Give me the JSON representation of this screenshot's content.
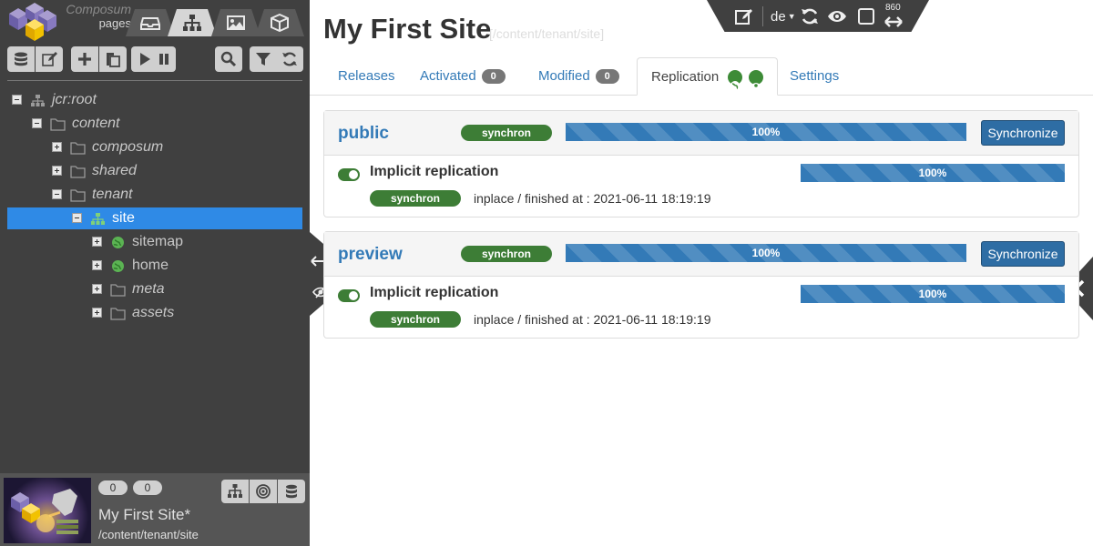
{
  "brand": {
    "line1": "Composum",
    "line2": "pages"
  },
  "toolbar_right": {
    "language": "de",
    "width_value": "860"
  },
  "tree": [
    {
      "label": "jcr:root",
      "italic": true,
      "toggle": "minus",
      "icon": "sitemap-icon",
      "selected": false
    },
    {
      "label": "content",
      "italic": true,
      "toggle": "minus",
      "icon": "folder-icon",
      "selected": false
    },
    {
      "label": "composum",
      "italic": true,
      "toggle": "plus",
      "icon": "folder-icon",
      "selected": false
    },
    {
      "label": "shared",
      "italic": true,
      "toggle": "plus",
      "icon": "folder-icon",
      "selected": false
    },
    {
      "label": "tenant",
      "italic": true,
      "toggle": "minus",
      "icon": "folder-icon",
      "selected": false
    },
    {
      "label": "site",
      "italic": false,
      "toggle": "minus",
      "icon": "sitemap-icon",
      "selected": true
    },
    {
      "label": "sitemap",
      "italic": false,
      "toggle": "plus",
      "icon": "globe-icon",
      "selected": false
    },
    {
      "label": "home",
      "italic": false,
      "toggle": "plus",
      "icon": "globe-icon",
      "selected": false
    },
    {
      "label": "meta",
      "italic": true,
      "toggle": "plus",
      "icon": "folder-icon",
      "selected": false
    },
    {
      "label": "assets",
      "italic": true,
      "toggle": "plus",
      "icon": "folder-icon",
      "selected": false
    }
  ],
  "bottom": {
    "count1": "0",
    "count2": "0",
    "title": "My First Site*",
    "path": "/content/tenant/site"
  },
  "page": {
    "title": "My First Site",
    "path": "[/content/tenant/site]"
  },
  "tabs": {
    "releases": "Releases",
    "activated": "Activated",
    "activated_count": "0",
    "modified": "Modified",
    "modified_count": "0",
    "replication": "Replication",
    "settings": "Settings"
  },
  "panels": [
    {
      "name": "public",
      "state": "synchron",
      "progress": "100%",
      "progress_value": 100,
      "button": "Synchronize",
      "implicit_label": "Implicit replication",
      "implicit_state": "synchron",
      "implicit_progress": "100%",
      "implicit_progress_value": 100,
      "info": "inplace  /  finished at : 2021-06-11 18:19:19"
    },
    {
      "name": "preview",
      "state": "synchron",
      "progress": "100%",
      "progress_value": 100,
      "button": "Synchronize",
      "implicit_label": "Implicit replication",
      "implicit_state": "synchron",
      "implicit_progress": "100%",
      "implicit_progress_value": 100,
      "info": "inplace  /  finished at : 2021-06-11 18:19:19"
    }
  ],
  "colors": {
    "sidebar_bg": "#404040",
    "selection": "#2f8ae6",
    "link": "#337ab7",
    "success": "#3d7d36",
    "progress": "#337ab7"
  }
}
